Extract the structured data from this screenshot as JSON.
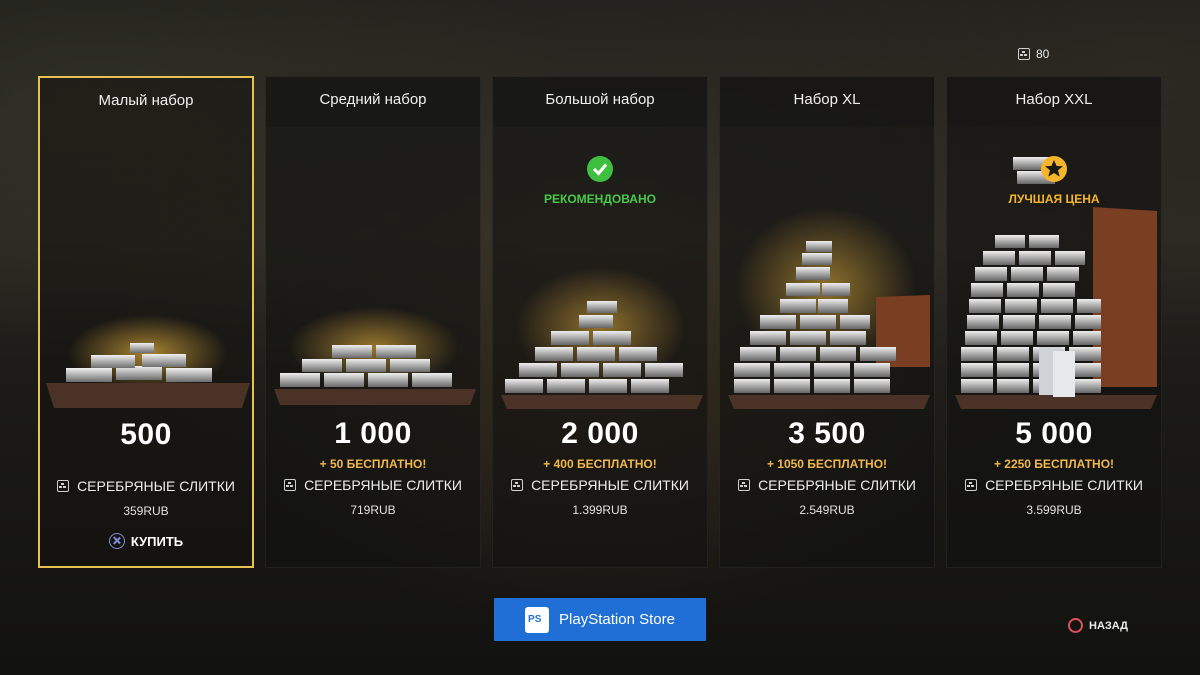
{
  "currency_balance": {
    "amount": "80",
    "icon": "silver-bar-icon"
  },
  "packs": [
    {
      "title": "Малый набор",
      "amount": "500",
      "bonus": "",
      "currency": "СЕРЕБРЯНЫЕ СЛИТКИ",
      "price": "359RUB",
      "badge": "",
      "selected": true
    },
    {
      "title": "Средний набор",
      "amount": "1 000",
      "bonus": "+ 50 БЕСПЛАТНО!",
      "currency": "СЕРЕБРЯНЫЕ СЛИТКИ",
      "price": "719RUB",
      "badge": "",
      "selected": false
    },
    {
      "title": "Большой набор",
      "amount": "2 000",
      "bonus": "+ 400 БЕСПЛАТНО!",
      "currency": "СЕРЕБРЯНЫЕ СЛИТКИ",
      "price": "1.399RUB",
      "badge": "РЕКОМЕНДОВАНО",
      "selected": false
    },
    {
      "title": "Набор XL",
      "amount": "3 500",
      "bonus": "+ 1050 БЕСПЛАТНО!",
      "currency": "СЕРЕБРЯНЫЕ СЛИТКИ",
      "price": "2.549RUB",
      "badge": "",
      "selected": false
    },
    {
      "title": "Набор XXL",
      "amount": "5 000",
      "bonus": "+ 2250 БЕСПЛАТНО!",
      "currency": "СЕРЕБРЯНЫЕ СЛИТКИ",
      "price": "3.599RUB",
      "badge": "ЛУЧШАЯ ЦЕНА",
      "selected": false
    }
  ],
  "buy_label": "КУПИТЬ",
  "store_button": "PlayStation Store",
  "back_label": "НАЗАД",
  "colors": {
    "highlight": "#e8c153",
    "bonus": "#f0b84a",
    "recommended": "#49c94a",
    "best_price": "#f4b52c",
    "store_blue": "#1f6fd6"
  }
}
